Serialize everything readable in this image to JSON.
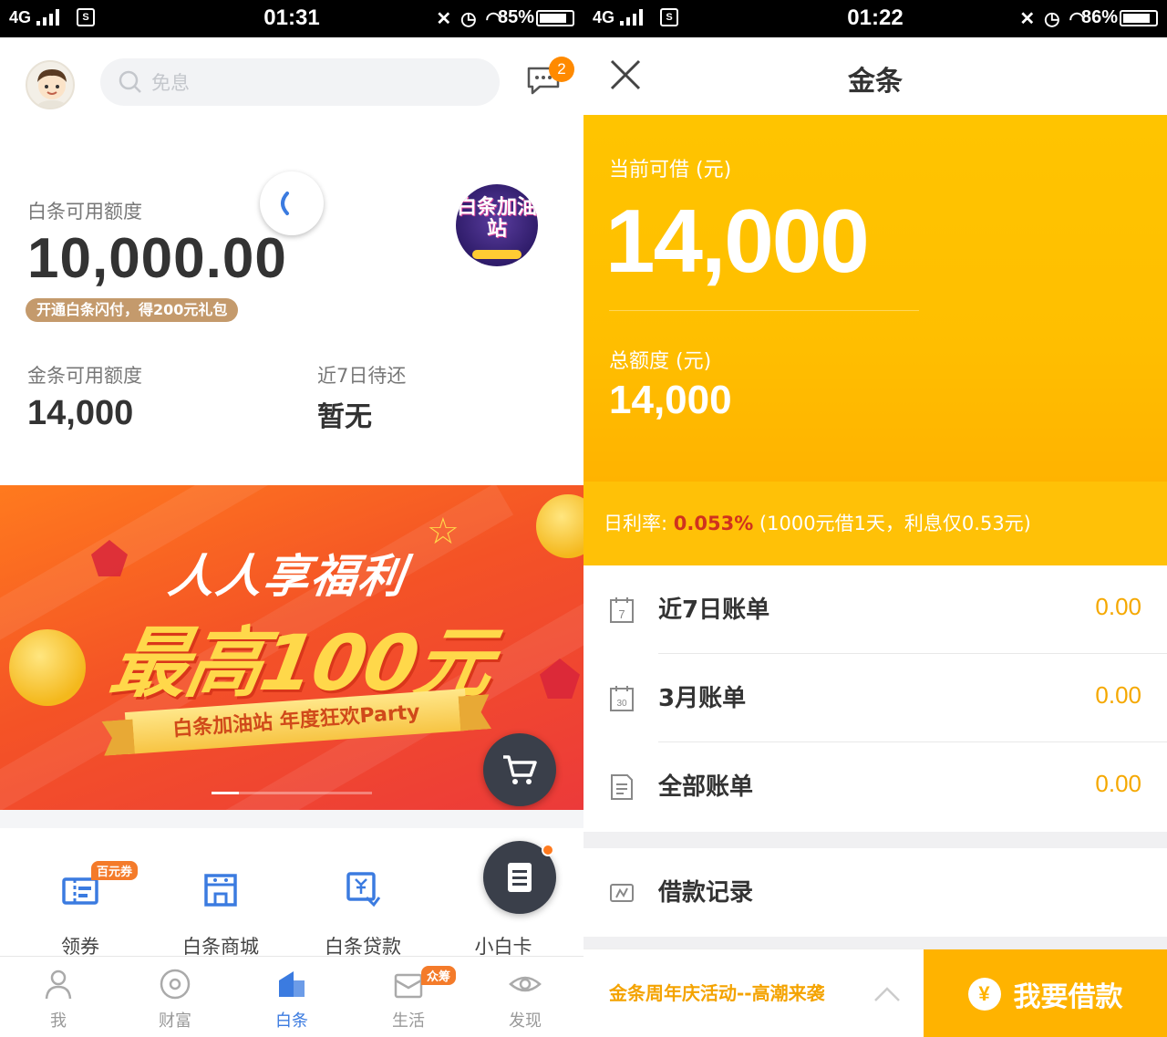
{
  "left": {
    "status": {
      "network": "4G",
      "sim": "S",
      "time": "01:31",
      "battery": "85%",
      "battery_level": 0.85
    },
    "search": {
      "placeholder": "免息"
    },
    "messages": {
      "badge": "2"
    },
    "baitiao": {
      "label": "白条可用额度",
      "amount": "10,000.00",
      "promo": "开通白条闪付，得200元礼包"
    },
    "station": {
      "text": "白条加油站"
    },
    "jintiao": {
      "label": "金条可用额度",
      "value": "14,000"
    },
    "due": {
      "label": "近7日待还",
      "value": "暂无"
    },
    "banner": {
      "line1": "人人享福利",
      "line2": "最高100元",
      "ribbon": "白条加油站 年度狂欢Party"
    },
    "grid": [
      {
        "label": "领券",
        "badge": "百元券",
        "icon": "coupon-icon"
      },
      {
        "label": "白条商城",
        "icon": "shop-icon"
      },
      {
        "label": "白条贷款",
        "icon": "loan-icon"
      },
      {
        "label": "小白卡",
        "icon": "card-icon"
      }
    ],
    "tabs": [
      {
        "label": "我",
        "icon": "person-icon"
      },
      {
        "label": "财富",
        "icon": "wealth-icon"
      },
      {
        "label": "白条",
        "icon": "baitiao-icon",
        "active": true
      },
      {
        "label": "生活",
        "icon": "life-icon",
        "badge": "众筹"
      },
      {
        "label": "发现",
        "icon": "eye-icon"
      }
    ]
  },
  "right": {
    "status": {
      "network": "4G",
      "sim": "S",
      "time": "01:22",
      "battery": "86%",
      "battery_level": 0.86
    },
    "title": "金条",
    "hero": {
      "available_label": "当前可借 (元)",
      "available": "14,000",
      "total_label": "总额度 (元)",
      "total": "14,000"
    },
    "rate": {
      "label": "日利率:",
      "value": "0.053%",
      "note": "(1000元借1天，利息仅0.53元)"
    },
    "bills": [
      {
        "label": "近7日账单",
        "value": "0.00",
        "icon": "calendar-7-icon"
      },
      {
        "label": "3月账单",
        "value": "0.00",
        "icon": "calendar-30-icon"
      },
      {
        "label": "全部账单",
        "value": "0.00",
        "icon": "document-icon"
      }
    ],
    "record": {
      "label": "借款记录",
      "icon": "record-icon"
    },
    "footer": {
      "promo": "金条周年庆活动--高潮来袭",
      "cta": "我要借款",
      "yen": "¥"
    }
  },
  "colors": {
    "accent_blue": "#3b7be0",
    "gold": "#ffc107",
    "orange": "#ff8a00",
    "amount_red": "#d0321e"
  }
}
